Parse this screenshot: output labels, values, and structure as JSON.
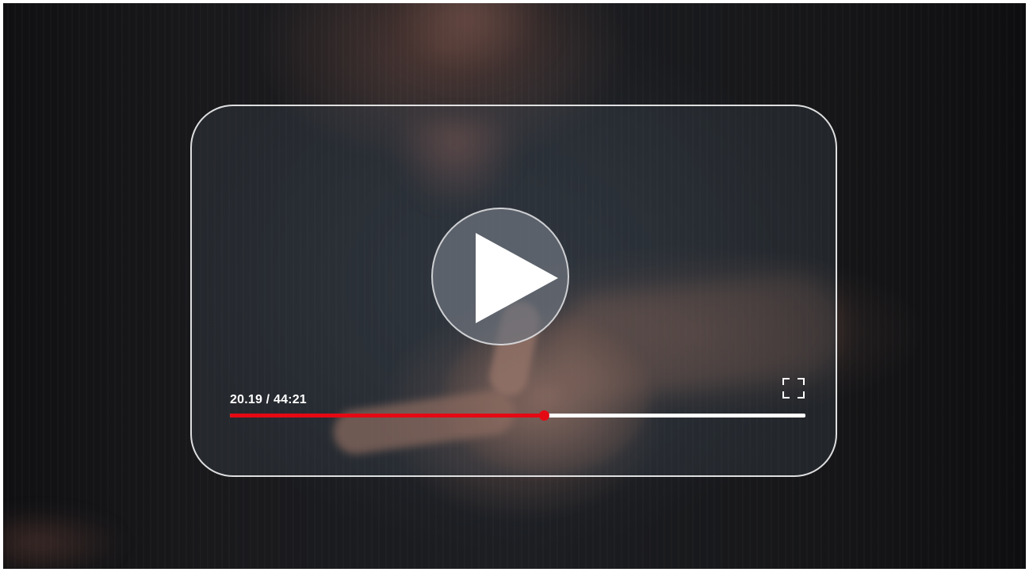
{
  "player": {
    "time_label": "20.19 / 44:21",
    "progress_fraction": 0.545,
    "colors": {
      "progress_played": "#e50914",
      "progress_remaining": "#ffffff",
      "play_icon": "#ffffff"
    },
    "icons": {
      "play": "play-icon",
      "fullscreen": "fullscreen-icon"
    }
  }
}
